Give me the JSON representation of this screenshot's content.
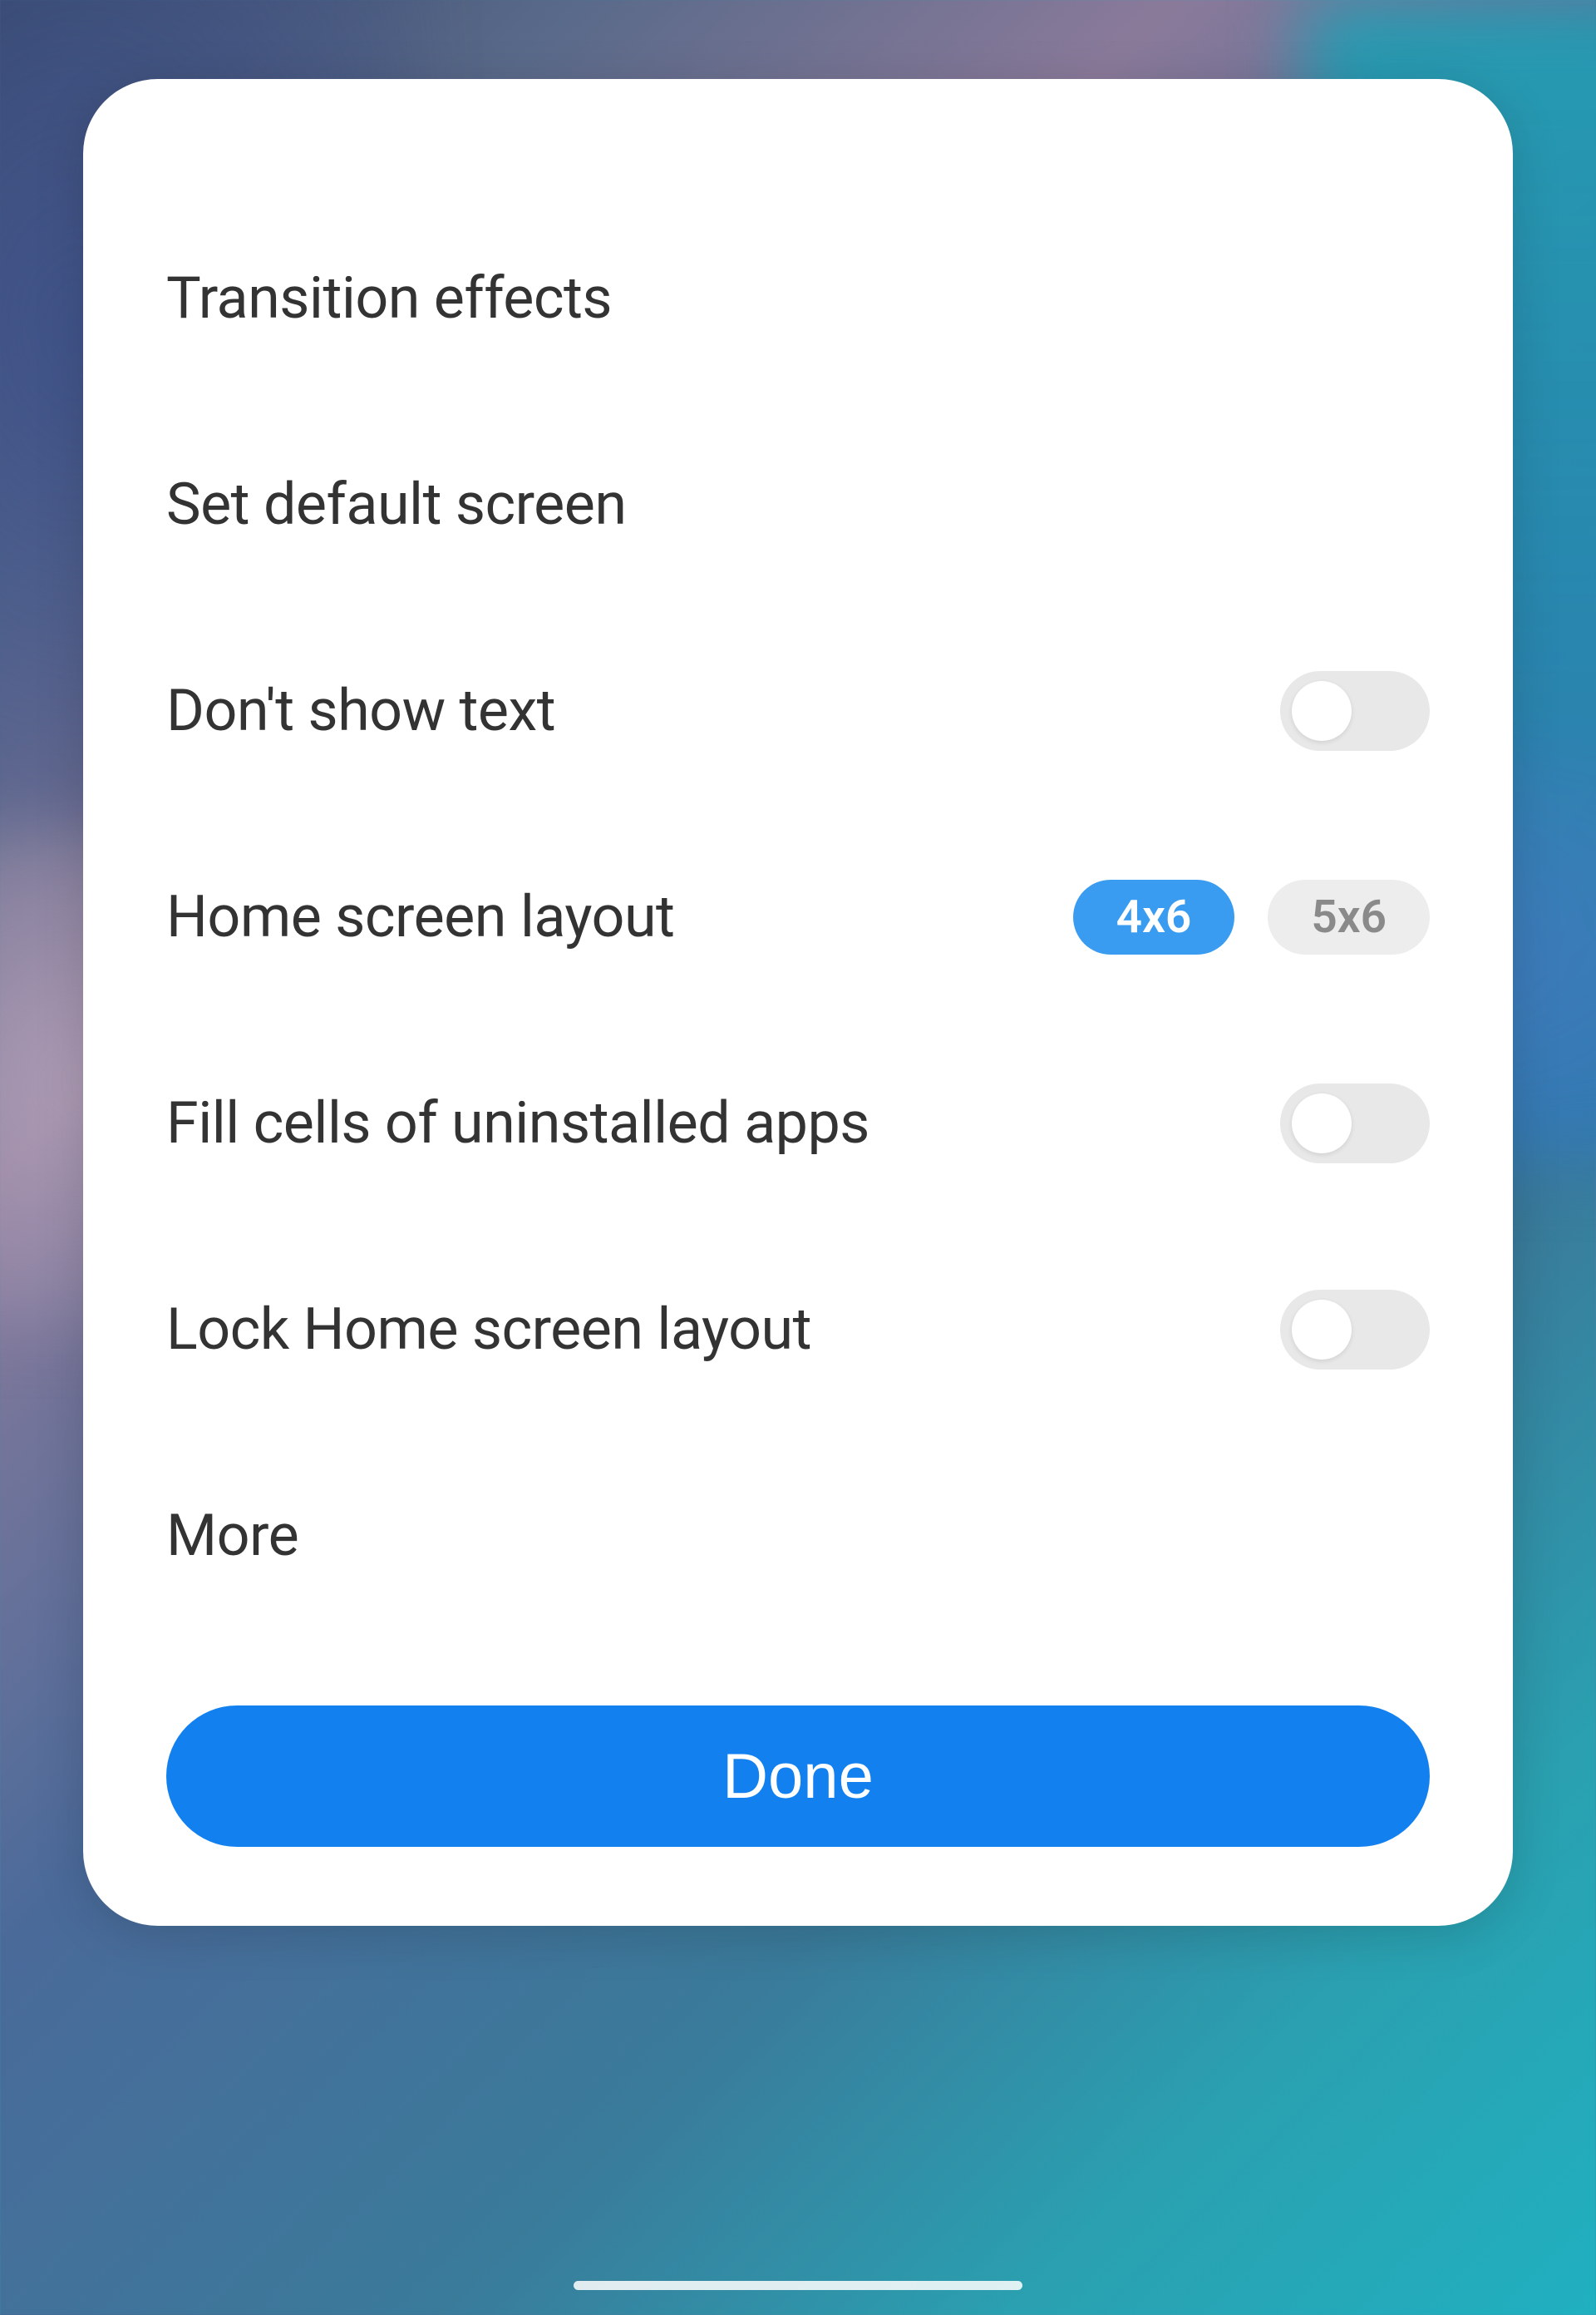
{
  "settings": {
    "transition_effects": {
      "label": "Transition effects"
    },
    "default_screen": {
      "label": "Set default screen"
    },
    "dont_show_text": {
      "label": "Don't show text",
      "enabled": false
    },
    "home_layout": {
      "label": "Home screen layout",
      "options": {
        "selected": "4x6",
        "unselected": "5x6"
      }
    },
    "fill_cells": {
      "label": "Fill cells of uninstalled apps",
      "enabled": false
    },
    "lock_layout": {
      "label": "Lock Home screen layout",
      "enabled": false
    },
    "more": {
      "label": "More"
    }
  },
  "done_button": "Done",
  "colors": {
    "accent": "#1380f0",
    "pill_selected": "#3a9cf0",
    "toggle_off": "#e8e8e8",
    "text": "#333333"
  }
}
